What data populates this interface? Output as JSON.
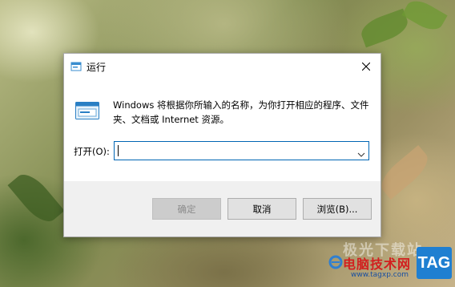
{
  "dialog": {
    "title": "运行",
    "description": "Windows 将根据你所输入的名称，为你打开相应的程序、文件夹、文档或 Internet 资源。",
    "open_label": "打开(O):",
    "input_value": "",
    "buttons": {
      "ok": "确定",
      "cancel": "取消",
      "browse": "浏览(B)..."
    },
    "icons": {
      "title": "run-icon",
      "close": "close-icon",
      "main": "run-program-icon",
      "dropdown": "chevron-down-icon"
    }
  },
  "watermark": {
    "faint_text": "极光下载站",
    "site_name": "电脑技术网",
    "url": "www.tagxp.com",
    "tag": "TAG"
  },
  "colors": {
    "focus_border": "#0066b4",
    "footer_bg": "#f0f0f0",
    "watermark_red": "#d21f1f",
    "tag_blue": "#1f7fd1"
  }
}
